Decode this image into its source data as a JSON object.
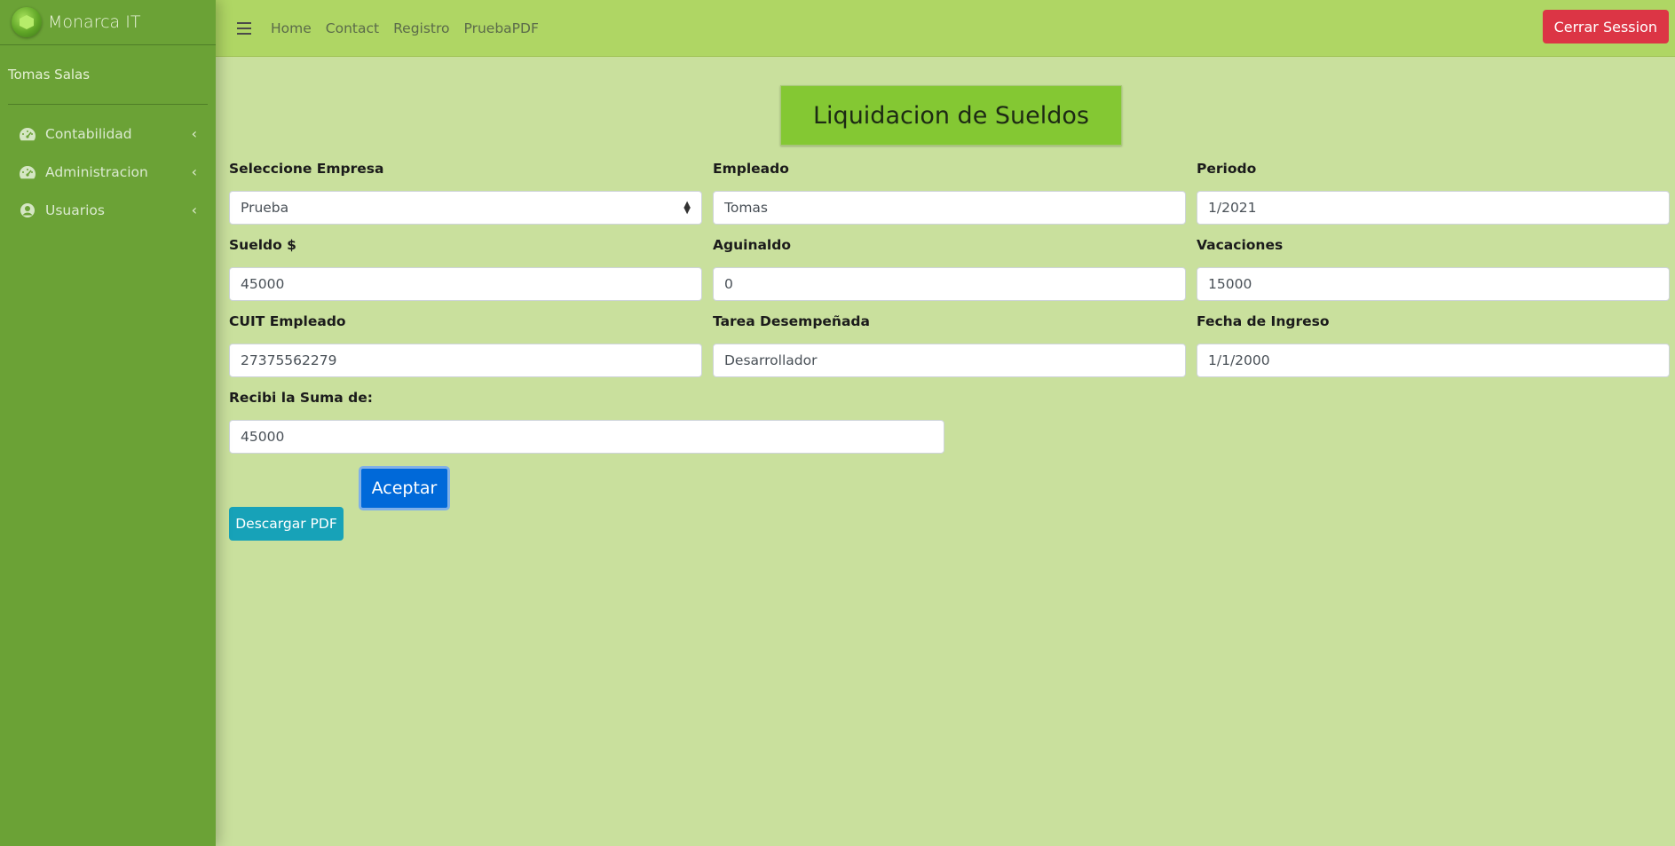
{
  "brand": {
    "name": "Monarca IT"
  },
  "user": {
    "name": "Tomas Salas"
  },
  "sidebar": {
    "items": [
      {
        "label": "Contabilidad",
        "icon": "tachometer-icon"
      },
      {
        "label": "Administracion",
        "icon": "tachometer-icon"
      },
      {
        "label": "Usuarios",
        "icon": "user-circle-icon"
      }
    ]
  },
  "topnav": {
    "links": [
      "Home",
      "Contact",
      "Registro",
      "PruebaPDF"
    ],
    "logout_label": "Cerrar Session"
  },
  "page": {
    "title": "Liquidacion de Sueldos"
  },
  "form": {
    "empresa": {
      "label": "Seleccione Empresa",
      "value": "Prueba"
    },
    "empleado": {
      "label": "Empleado",
      "value": "Tomas"
    },
    "periodo": {
      "label": "Periodo",
      "value": "1/2021"
    },
    "sueldo": {
      "label": "Sueldo $",
      "value": "45000"
    },
    "aguinaldo": {
      "label": "Aguinaldo",
      "value": "0"
    },
    "vacaciones": {
      "label": "Vacaciones",
      "value": "15000"
    },
    "cuit": {
      "label": "CUIT Empleado",
      "value": "27375562279"
    },
    "tarea": {
      "label": "Tarea Desempeñada",
      "value": "Desarrollador"
    },
    "fecha_ingreso": {
      "label": "Fecha de Ingreso",
      "value": "1/1/2000"
    },
    "suma": {
      "label": "Recibi la Suma de:",
      "value": "45000"
    },
    "accept_label": "Aceptar",
    "pdf_label": "Descargar PDF"
  },
  "colors": {
    "sidebar": "#6ba236",
    "topbar": "#afd664",
    "content_bg": "#c9e09d",
    "title_bg": "#84c833",
    "logout": "#dc3545",
    "accept": "#0069d9",
    "pdf": "#17a2b8"
  }
}
